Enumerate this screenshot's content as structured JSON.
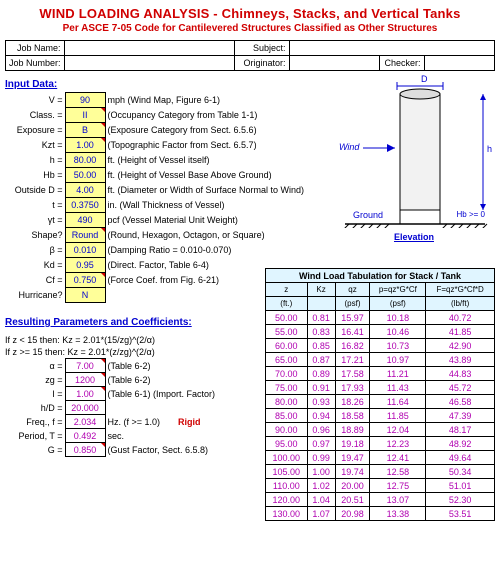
{
  "title": "WIND LOADING ANALYSIS - Chimneys, Stacks, and Vertical Tanks",
  "subtitle": "Per ASCE 7-05 Code for Cantilevered Structures Classified as Other Structures",
  "hdr": {
    "job_name_lbl": "Job Name:",
    "job_num_lbl": "Job Number:",
    "subject_lbl": "Subject:",
    "originator_lbl": "Originator:",
    "checker_lbl": "Checker:",
    "job_name": "",
    "job_number": "",
    "subject": "",
    "originator": "",
    "checker": ""
  },
  "section_input": "Input Data:",
  "inputs": [
    {
      "lbl": "V =",
      "val": "90",
      "desc": "mph  (Wind Map, Figure 6-1)"
    },
    {
      "lbl": "Class. =",
      "val": "II",
      "desc": "(Occupancy Category from Table 1-1)"
    },
    {
      "lbl": "Exposure =",
      "val": "B",
      "desc": "(Exposure Category from Sect. 6.5.6)"
    },
    {
      "lbl": "Kzt =",
      "val": "1.00",
      "desc": "(Topographic Factor from Sect. 6.5.7)"
    },
    {
      "lbl": "h =",
      "val": "80.00",
      "desc": "ft.  (Height of Vessel itself)"
    },
    {
      "lbl": "Hb =",
      "val": "50.00",
      "desc": "ft.  (Height of Vessel Base Above Ground)"
    },
    {
      "lbl": "Outside D =",
      "val": "4.00",
      "desc": "ft.  (Diameter or Width of Surface Normal to Wind)"
    },
    {
      "lbl": "t =",
      "val": "0.3750",
      "desc": "in.  (Wall Thickness of Vessel)"
    },
    {
      "lbl": "γt =",
      "val": "490",
      "desc": "pcf  (Vessel Material Unit Weight)"
    },
    {
      "lbl": "Shape?",
      "val": "Round",
      "desc": "(Round, Hexagon, Octagon, or Square)"
    },
    {
      "lbl": "β =",
      "val": "0.010",
      "desc": "(Damping Ratio = 0.010-0.070)"
    },
    {
      "lbl": "Kd =",
      "val": "0.95",
      "desc": "(Direct. Factor, Table 6-4)"
    },
    {
      "lbl": "Cf =",
      "val": "0.750",
      "desc": "(Force Coef. from Fig. 6-21)"
    },
    {
      "lbl": "Hurricane?",
      "val": "N",
      "desc": ""
    }
  ],
  "elev": {
    "D": "D",
    "wind": "Wind",
    "h": "h",
    "hb": "Hb >= 0",
    "ground": "Ground",
    "label": "Elevation"
  },
  "tab_title": "Wind Load Tabulation for Stack / Tank",
  "tab_headers": [
    {
      "a": "z",
      "b": "(ft.)"
    },
    {
      "a": "Kz",
      "b": ""
    },
    {
      "a": "qz",
      "b": "(psf)"
    },
    {
      "a": "p=qz*G*Cf",
      "b": "(psf)"
    },
    {
      "a": "F=qz*G*Cf*D",
      "b": "(lb/ft)"
    }
  ],
  "chart_data": {
    "type": "table",
    "columns": [
      "z (ft.)",
      "Kz",
      "qz (psf)",
      "p=qz*G*Cf (psf)",
      "F=qz*G*Cf*D (lb/ft)"
    ],
    "rows": [
      [
        "50.00",
        "0.81",
        "15.97",
        "10.18",
        "40.72"
      ],
      [
        "55.00",
        "0.83",
        "16.41",
        "10.46",
        "41.85"
      ],
      [
        "60.00",
        "0.85",
        "16.82",
        "10.73",
        "42.90"
      ],
      [
        "65.00",
        "0.87",
        "17.21",
        "10.97",
        "43.89"
      ],
      [
        "70.00",
        "0.89",
        "17.58",
        "11.21",
        "44.83"
      ],
      [
        "75.00",
        "0.91",
        "17.93",
        "11.43",
        "45.72"
      ],
      [
        "80.00",
        "0.93",
        "18.26",
        "11.64",
        "46.58"
      ],
      [
        "85.00",
        "0.94",
        "18.58",
        "11.85",
        "47.39"
      ],
      [
        "90.00",
        "0.96",
        "18.89",
        "12.04",
        "48.17"
      ],
      [
        "95.00",
        "0.97",
        "19.18",
        "12.23",
        "48.92"
      ],
      [
        "100.00",
        "0.99",
        "19.47",
        "12.41",
        "49.64"
      ],
      [
        "105.00",
        "1.00",
        "19.74",
        "12.58",
        "50.34"
      ],
      [
        "110.00",
        "1.02",
        "20.00",
        "12.75",
        "51.01"
      ],
      [
        "120.00",
        "1.04",
        "20.51",
        "13.07",
        "52.30"
      ],
      [
        "130.00",
        "1.07",
        "20.98",
        "13.38",
        "53.51"
      ]
    ]
  },
  "section_results": "Resulting Parameters and Coefficients:",
  "notes": {
    "n1": "If z < 15 then:  Kz = 2.01*(15/zg)^(2/α)",
    "n2": "If z >= 15 then:  Kz = 2.01*(z/zg)^(2/α)"
  },
  "results": [
    {
      "lbl": "α =",
      "val": "7.00",
      "desc": "(Table 6-2)"
    },
    {
      "lbl": "zg =",
      "val": "1200",
      "desc": "(Table 6-2)"
    },
    {
      "lbl": "I =",
      "val": "1.00",
      "desc": "(Table 6-1)  (Import. Factor)"
    },
    {
      "lbl": "h/D =",
      "val": "20.000",
      "desc": ""
    },
    {
      "lbl": "Freq., f =",
      "val": "2.034",
      "desc": "Hz.  (f >= 1.0)",
      "extra": "Rigid"
    },
    {
      "lbl": "Period, T =",
      "val": "0.492",
      "desc": "sec."
    },
    {
      "lbl": "G =",
      "val": "0.850",
      "desc": "(Gust Factor, Sect. 6.5.8)"
    }
  ]
}
